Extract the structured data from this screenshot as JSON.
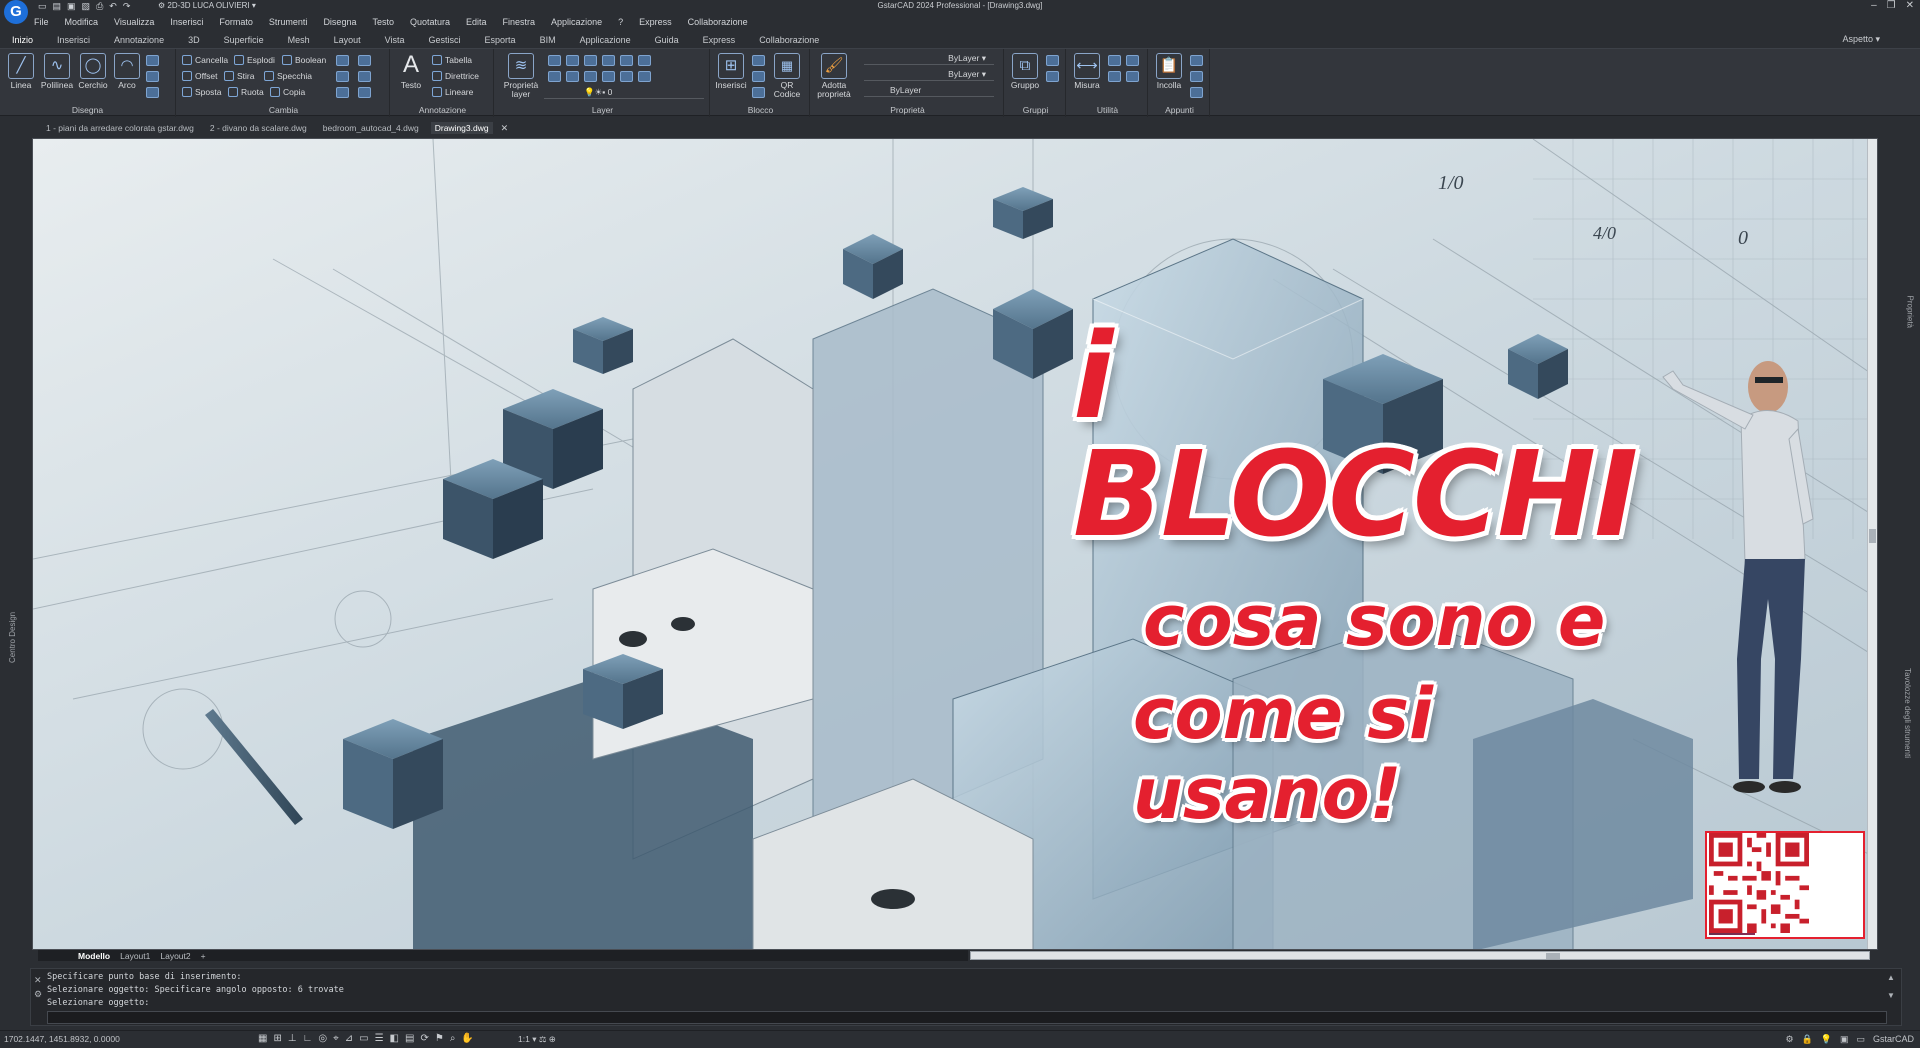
{
  "app": {
    "window_title": "GstarCAD 2024 Professional - [Drawing3.dwg]",
    "logo_letter": "G",
    "workspace": "2D-3D LUCA OLIVIERI",
    "status_brand": "GstarCAD"
  },
  "menu": [
    "File",
    "Modifica",
    "Visualizza",
    "Inserisci",
    "Formato",
    "Strumenti",
    "Disegna",
    "Testo",
    "Quotatura",
    "Edita",
    "Finestra",
    "Applicazione",
    "?",
    "Express",
    "Collaborazione"
  ],
  "ribbon_tabs": [
    "Inizio",
    "Inserisci",
    "Annotazione",
    "3D",
    "Superficie",
    "Mesh",
    "Layout",
    "Vista",
    "Gestisci",
    "Esporta",
    "BIM",
    "Applicazione",
    "Guida",
    "Express",
    "Collaborazione"
  ],
  "aspect_label": "Aspetto",
  "panels": {
    "disegna": {
      "title": "Disegna",
      "tools": [
        "Linea",
        "Polilinea",
        "Cerchio",
        "Arco"
      ]
    },
    "cambia": {
      "title": "Cambia",
      "tools": [
        "Cancella",
        "Esplodi",
        "Boolean",
        "Offset",
        "Stira",
        "Specchia",
        "Sposta",
        "Ruota",
        "Copia"
      ]
    },
    "annotazione": {
      "title": "Annotazione",
      "big": "Testo",
      "tools": [
        "Tabella",
        "Direttrice",
        "Lineare"
      ]
    },
    "layer": {
      "title": "Layer",
      "big": "Proprietà layer",
      "layer_value": "0"
    },
    "blocco": {
      "title": "Blocco",
      "tools": [
        "Inserisci",
        "QR Codice"
      ]
    },
    "proprieta": {
      "title": "Proprietà",
      "big": "Adotta proprietà",
      "bylayer": [
        "ByLayer",
        "ByLayer",
        "ByLayer"
      ]
    },
    "gruppi": {
      "title": "Gruppi",
      "big": "Gruppo"
    },
    "utilita": {
      "title": "Utilità",
      "big": "Misura"
    },
    "appunti": {
      "title": "Appunti",
      "big": "Incolla"
    }
  },
  "doc_tabs": [
    "1 - piani da arredare colorata gstar.dwg",
    "2 - divano da scalare.dwg",
    "bedroom_autocad_4.dwg",
    "Drawing3.dwg"
  ],
  "side_labels": {
    "left": "Centro Design",
    "right_top": "Proprietà",
    "right_bottom": "Tavolozze degli strumenti"
  },
  "headline": {
    "line1": "i BLOCCHI",
    "line2": "cosa sono e",
    "line3": "come si usano!"
  },
  "canvas_labels": {
    "dim1": "1/0",
    "dim2": "0",
    "dim3": "4/0"
  },
  "layout_tabs": [
    "Modello",
    "Layout1",
    "Layout2",
    "+"
  ],
  "command_history": [
    "Specificare punto base di inserimento:",
    "Selezionare oggetto: Specificare angolo opposto:  6 trovate",
    "Selezionare oggetto:"
  ],
  "status": {
    "coords": "1702.1447, 1451.8932, 0.0000",
    "scale": "1:1"
  }
}
